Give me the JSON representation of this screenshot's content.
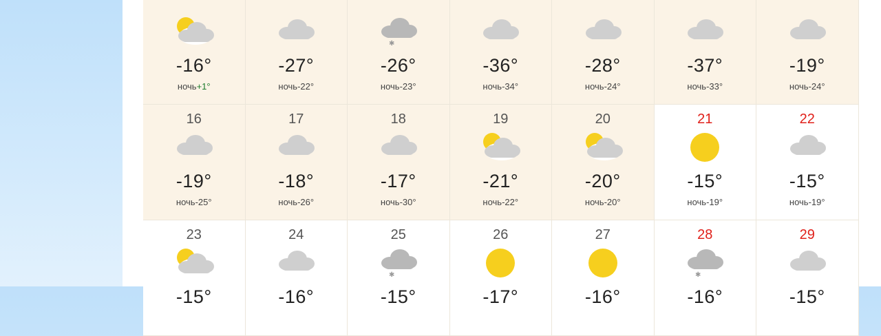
{
  "night_prefix": "ночь",
  "colors": {
    "sun": "#f6cf1e",
    "cloud": "#cfcfcf",
    "dark_cloud": "#b8b8b8",
    "weekend": "#e0201a"
  },
  "weeks": [
    [
      {
        "day": "",
        "icon": "partly-cloudy-icon",
        "temp": "-16°",
        "night": "+1°",
        "state": "past",
        "weekend": false
      },
      {
        "day": "",
        "icon": "cloud-icon",
        "temp": "-27°",
        "night": "-22°",
        "state": "past",
        "weekend": false
      },
      {
        "day": "",
        "icon": "snow-cloud-icon",
        "temp": "-26°",
        "night": "-23°",
        "state": "past",
        "weekend": false
      },
      {
        "day": "",
        "icon": "cloud-icon",
        "temp": "-36°",
        "night": "-34°",
        "state": "past",
        "weekend": false
      },
      {
        "day": "",
        "icon": "cloud-icon",
        "temp": "-28°",
        "night": "-24°",
        "state": "past",
        "weekend": false
      },
      {
        "day": "",
        "icon": "cloud-icon",
        "temp": "-37°",
        "night": "-33°",
        "state": "past",
        "weekend": false
      },
      {
        "day": "",
        "icon": "cloud-icon",
        "temp": "-19°",
        "night": "-24°",
        "state": "past",
        "weekend": false
      }
    ],
    [
      {
        "day": "16",
        "icon": "cloud-icon",
        "temp": "-19°",
        "night": "-25°",
        "state": "past",
        "weekend": false
      },
      {
        "day": "17",
        "icon": "cloud-icon",
        "temp": "-18°",
        "night": "-26°",
        "state": "past",
        "weekend": false
      },
      {
        "day": "18",
        "icon": "cloud-icon",
        "temp": "-17°",
        "night": "-30°",
        "state": "past",
        "weekend": false
      },
      {
        "day": "19",
        "icon": "partly-cloudy-icon",
        "temp": "-21°",
        "night": "-22°",
        "state": "past",
        "weekend": false
      },
      {
        "day": "20",
        "icon": "partly-cloudy-icon",
        "temp": "-20°",
        "night": "-20°",
        "state": "past",
        "weekend": false
      },
      {
        "day": "21",
        "icon": "sun-icon",
        "temp": "-15°",
        "night": "-19°",
        "state": "future",
        "weekend": true
      },
      {
        "day": "22",
        "icon": "cloud-icon",
        "temp": "-15°",
        "night": "-19°",
        "state": "future",
        "weekend": true
      }
    ],
    [
      {
        "day": "23",
        "icon": "partly-cloudy-icon",
        "temp": "-15°",
        "night": "",
        "state": "future",
        "weekend": false
      },
      {
        "day": "24",
        "icon": "cloud-icon",
        "temp": "-16°",
        "night": "",
        "state": "future",
        "weekend": false
      },
      {
        "day": "25",
        "icon": "snow-cloud-icon",
        "temp": "-15°",
        "night": "",
        "state": "future",
        "weekend": false
      },
      {
        "day": "26",
        "icon": "sun-icon",
        "temp": "-17°",
        "night": "",
        "state": "future",
        "weekend": false
      },
      {
        "day": "27",
        "icon": "sun-icon",
        "temp": "-16°",
        "night": "",
        "state": "future",
        "weekend": false
      },
      {
        "day": "28",
        "icon": "snow-cloud-icon",
        "temp": "-16°",
        "night": "",
        "state": "future",
        "weekend": true
      },
      {
        "day": "29",
        "icon": "cloud-icon",
        "temp": "-15°",
        "night": "",
        "state": "future",
        "weekend": true
      }
    ]
  ]
}
